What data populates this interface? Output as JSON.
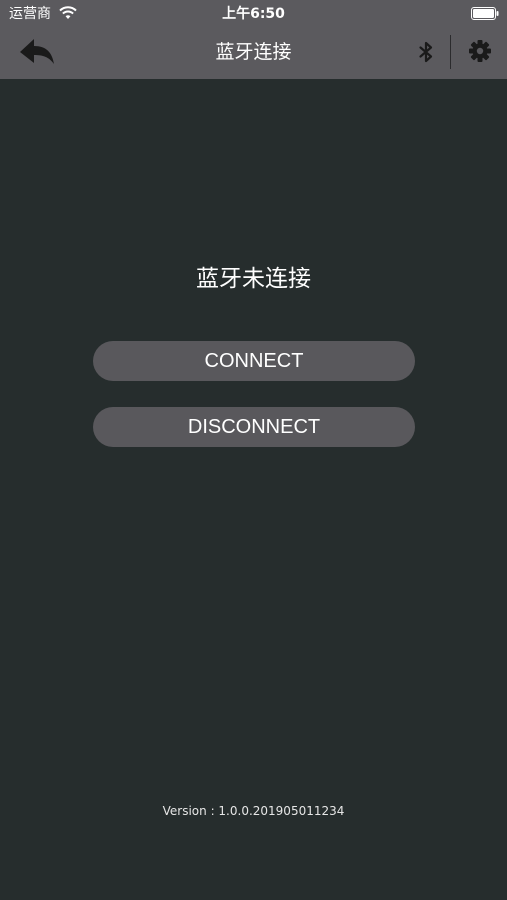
{
  "status_bar": {
    "carrier": "运营商",
    "time": "上午6:50",
    "wifi_icon": "wifi-icon",
    "battery_icon": "battery-icon"
  },
  "nav_bar": {
    "title": "蓝牙连接",
    "back_icon": "back-arrow-icon",
    "bluetooth_icon": "bluetooth-icon",
    "settings_icon": "gear-icon"
  },
  "main": {
    "status_text": "蓝牙未连接",
    "connect_label": "CONNECT",
    "disconnect_label": "DISCONNECT"
  },
  "footer": {
    "version_label": "Version",
    "version_separator": " : ",
    "version_number": "1.0.0.201905011234"
  },
  "colors": {
    "background": "#262d2d",
    "bar": "#5b5a5e",
    "button": "#59585c",
    "text": "#ffffff"
  }
}
